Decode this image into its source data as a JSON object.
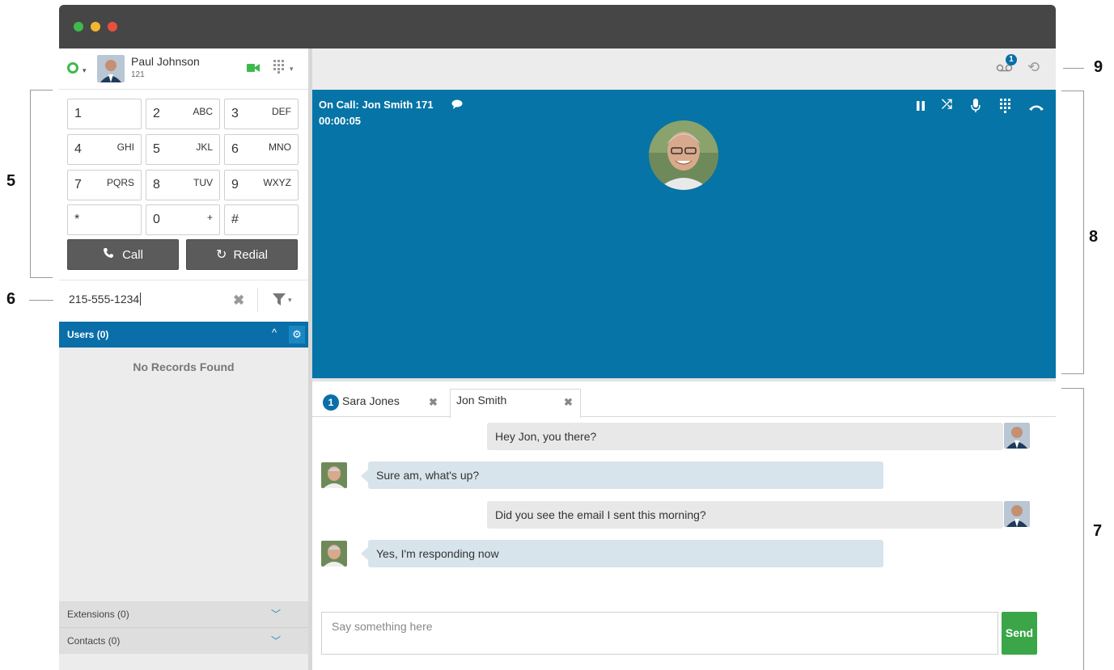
{
  "user": {
    "name": "Paul Johnson",
    "extension": "121"
  },
  "dialpad": {
    "keys": [
      {
        "digit": "1",
        "letters": ""
      },
      {
        "digit": "2",
        "letters": "ABC"
      },
      {
        "digit": "3",
        "letters": "DEF"
      },
      {
        "digit": "4",
        "letters": "GHI"
      },
      {
        "digit": "5",
        "letters": "JKL"
      },
      {
        "digit": "6",
        "letters": "MNO"
      },
      {
        "digit": "7",
        "letters": "PQRS"
      },
      {
        "digit": "8",
        "letters": "TUV"
      },
      {
        "digit": "9",
        "letters": "WXYZ"
      },
      {
        "digit": "*",
        "letters": ""
      },
      {
        "digit": "0",
        "letters": "+"
      },
      {
        "digit": "#",
        "letters": ""
      }
    ],
    "call_label": "Call",
    "redial_label": "Redial"
  },
  "search": {
    "value": "215-555-1234"
  },
  "users": {
    "title": "Users (0)",
    "empty": "No Records Found"
  },
  "extensions": {
    "title": "Extensions (0)"
  },
  "contacts": {
    "title": "Contacts (0)"
  },
  "topbar": {
    "voicemail_count": "1"
  },
  "call": {
    "status": "On Call: Jon Smith 171",
    "timer": "00:00:05"
  },
  "chat": {
    "tabs": [
      {
        "label": "Sara Jones",
        "badge": "1"
      },
      {
        "label": "Jon Smith",
        "badge": ""
      }
    ],
    "messages": [
      {
        "side": "right",
        "text": "Hey Jon, you there?"
      },
      {
        "side": "left",
        "text": "Sure am, what's up?"
      },
      {
        "side": "right",
        "text": "Did you see the email I sent this morning?"
      },
      {
        "side": "left",
        "text": "Yes, I'm responding now"
      }
    ],
    "input_placeholder": "Say something here",
    "send_label": "Send"
  },
  "callouts": {
    "n5": "5",
    "n6": "6",
    "n7": "7",
    "n8": "8",
    "n9": "9"
  },
  "colors": {
    "accent": "#0674a6",
    "send": "#3aa648",
    "status_online": "#4caf50"
  }
}
